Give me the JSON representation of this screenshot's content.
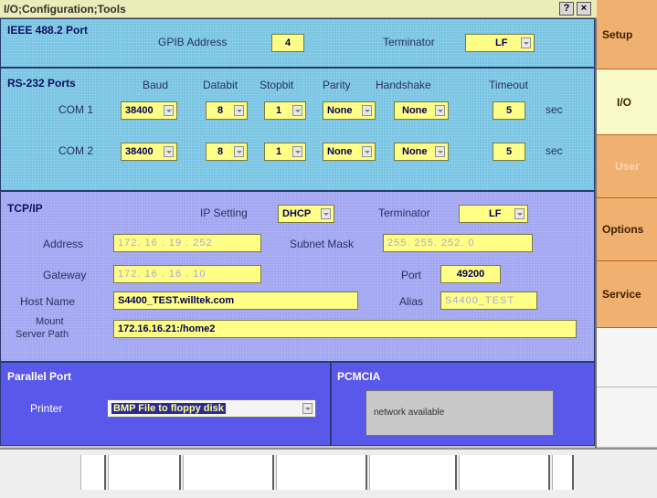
{
  "window": {
    "title": "I/O;Configuration;Tools",
    "help_label": "?",
    "close_label": "×"
  },
  "ieee": {
    "title": "IEEE 488.2 Port",
    "gpib_label": "GPIB Address",
    "gpib_value": "4",
    "terminator_label": "Terminator",
    "terminator_value": "LF"
  },
  "rs232": {
    "title": "RS-232 Ports",
    "headers": {
      "baud": "Baud",
      "databit": "Databit",
      "stopbit": "Stopbit",
      "parity": "Parity",
      "handshake": "Handshake",
      "timeout": "Timeout"
    },
    "ports": [
      {
        "name": "COM 1",
        "baud": "38400",
        "databit": "8",
        "stopbit": "1",
        "parity": "None",
        "handshake": "None",
        "timeout": "5",
        "unit": "sec"
      },
      {
        "name": "COM 2",
        "baud": "38400",
        "databit": "8",
        "stopbit": "1",
        "parity": "None",
        "handshake": "None",
        "timeout": "5",
        "unit": "sec"
      }
    ]
  },
  "tcpip": {
    "title": "TCP/IP",
    "ip_setting_label": "IP Setting",
    "ip_setting_value": "DHCP",
    "terminator_label": "Terminator",
    "terminator_value": "LF",
    "address_label": "Address",
    "address_value": "172. 16 . 19 . 252",
    "subnet_label": "Subnet Mask",
    "subnet_value": "255. 255. 252. 0",
    "gateway_label": "Gateway",
    "gateway_value": "172. 16 . 16 . 10",
    "port_label": "Port",
    "port_value": "49200",
    "hostname_label": "Host Name",
    "hostname_value": "S4400_TEST.willtek.com",
    "alias_label": "Alias",
    "alias_value": "S4400_TEST",
    "mount_label_1": "Mount",
    "mount_label_2": "Server Path",
    "mount_value": "172.16.16.21:/home2"
  },
  "parallel": {
    "title": "Parallel Port",
    "printer_label": "Printer",
    "printer_value": "BMP File to floppy disk"
  },
  "pcmcia": {
    "title": "PCMCIA",
    "status": "network available"
  },
  "side_menu": [
    {
      "label": "Setup",
      "state": "normal"
    },
    {
      "label": "I/O",
      "state": "active"
    },
    {
      "label": "User",
      "state": "disabled"
    },
    {
      "label": "Options",
      "state": "normal"
    },
    {
      "label": "Service",
      "state": "normal"
    }
  ],
  "colors": {
    "accent_orange": "#f0b070",
    "field_yellow": "#ffff88",
    "rs232_cyan": "#7cc6e4",
    "tcpip_lavender": "#a4a8f2",
    "parallel_blue": "#5a58ea"
  }
}
